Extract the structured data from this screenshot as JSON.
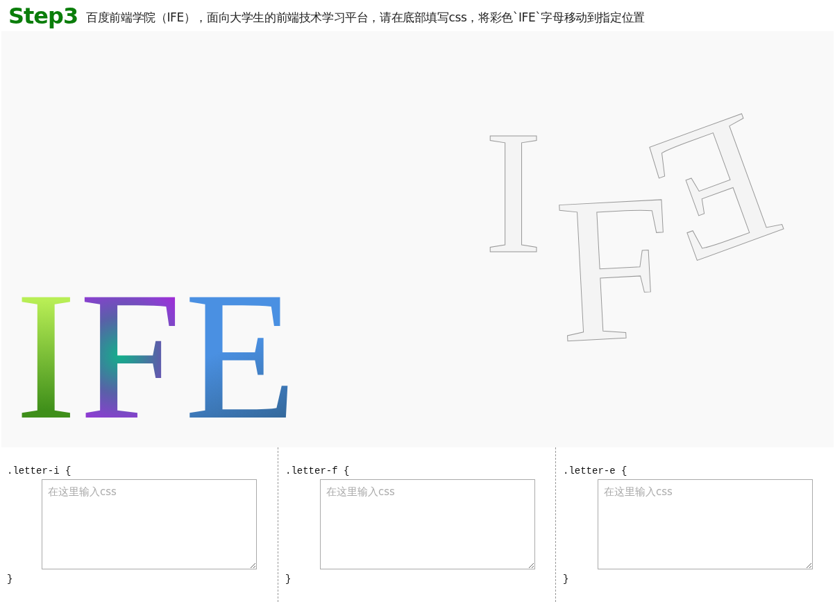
{
  "header": {
    "step": "Step3",
    "description": "百度前端学院（IFE），面向大学生的前端技术学习平台，请在底部填写css，将彩色`IFE`字母移动到指定位置"
  },
  "stage": {
    "letters": [
      {
        "char": "I",
        "kind": "i"
      },
      {
        "char": "F",
        "kind": "f"
      },
      {
        "char": "E",
        "kind": "e"
      }
    ],
    "targets": [
      {
        "char": "I",
        "kind": "i"
      },
      {
        "char": "F",
        "kind": "f"
      },
      {
        "char": "E",
        "kind": "e"
      }
    ]
  },
  "editors": [
    {
      "selector": ".letter-i {",
      "placeholder": "在这里输入css",
      "closing": "}"
    },
    {
      "selector": ".letter-f {",
      "placeholder": "在这里输入css",
      "closing": "}"
    },
    {
      "selector": ".letter-e {",
      "placeholder": "在这里输入css",
      "closing": "}"
    }
  ]
}
